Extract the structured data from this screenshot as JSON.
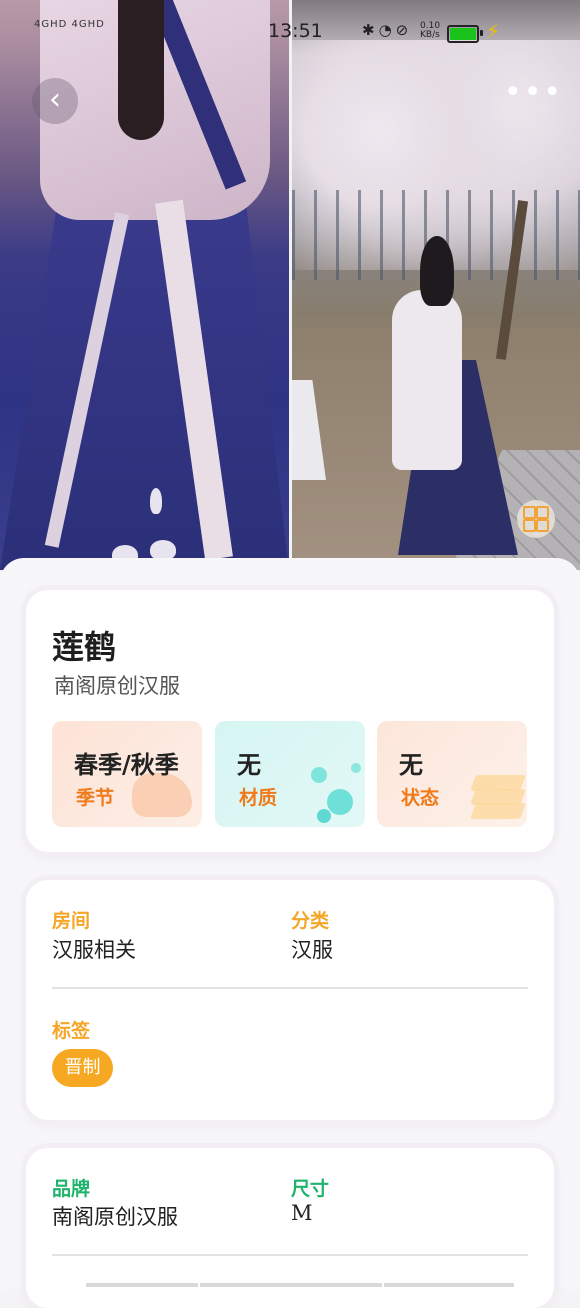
{
  "status_bar": {
    "signal": "4GHD 4GHD",
    "time": "13:51",
    "icons": "✱◔⊘",
    "net_speed": "0.10 KB/s",
    "charging": "⚡"
  },
  "nav": {
    "back_icon": "‹",
    "more_icon": "•••"
  },
  "item": {
    "name": "莲鹤",
    "brand_line": "南阁原创汉服"
  },
  "tiles": [
    {
      "value": "春季/秋季",
      "label": "季节"
    },
    {
      "value": "无",
      "label": "材质"
    },
    {
      "value": "无",
      "label": "状态"
    }
  ],
  "details": {
    "room_label": "房间",
    "room_value": "汉服相关",
    "category_label": "分类",
    "category_value": "汉服",
    "tags_label": "标签",
    "tag": "晋制"
  },
  "specs": {
    "brand_label": "品牌",
    "brand_value": "南阁原创汉服",
    "size_label": "尺寸",
    "size_value": "M"
  },
  "colors": {
    "accent_orange": "#f5a627",
    "accent_green": "#1fb36c",
    "tile_label": "#f07a1a"
  }
}
